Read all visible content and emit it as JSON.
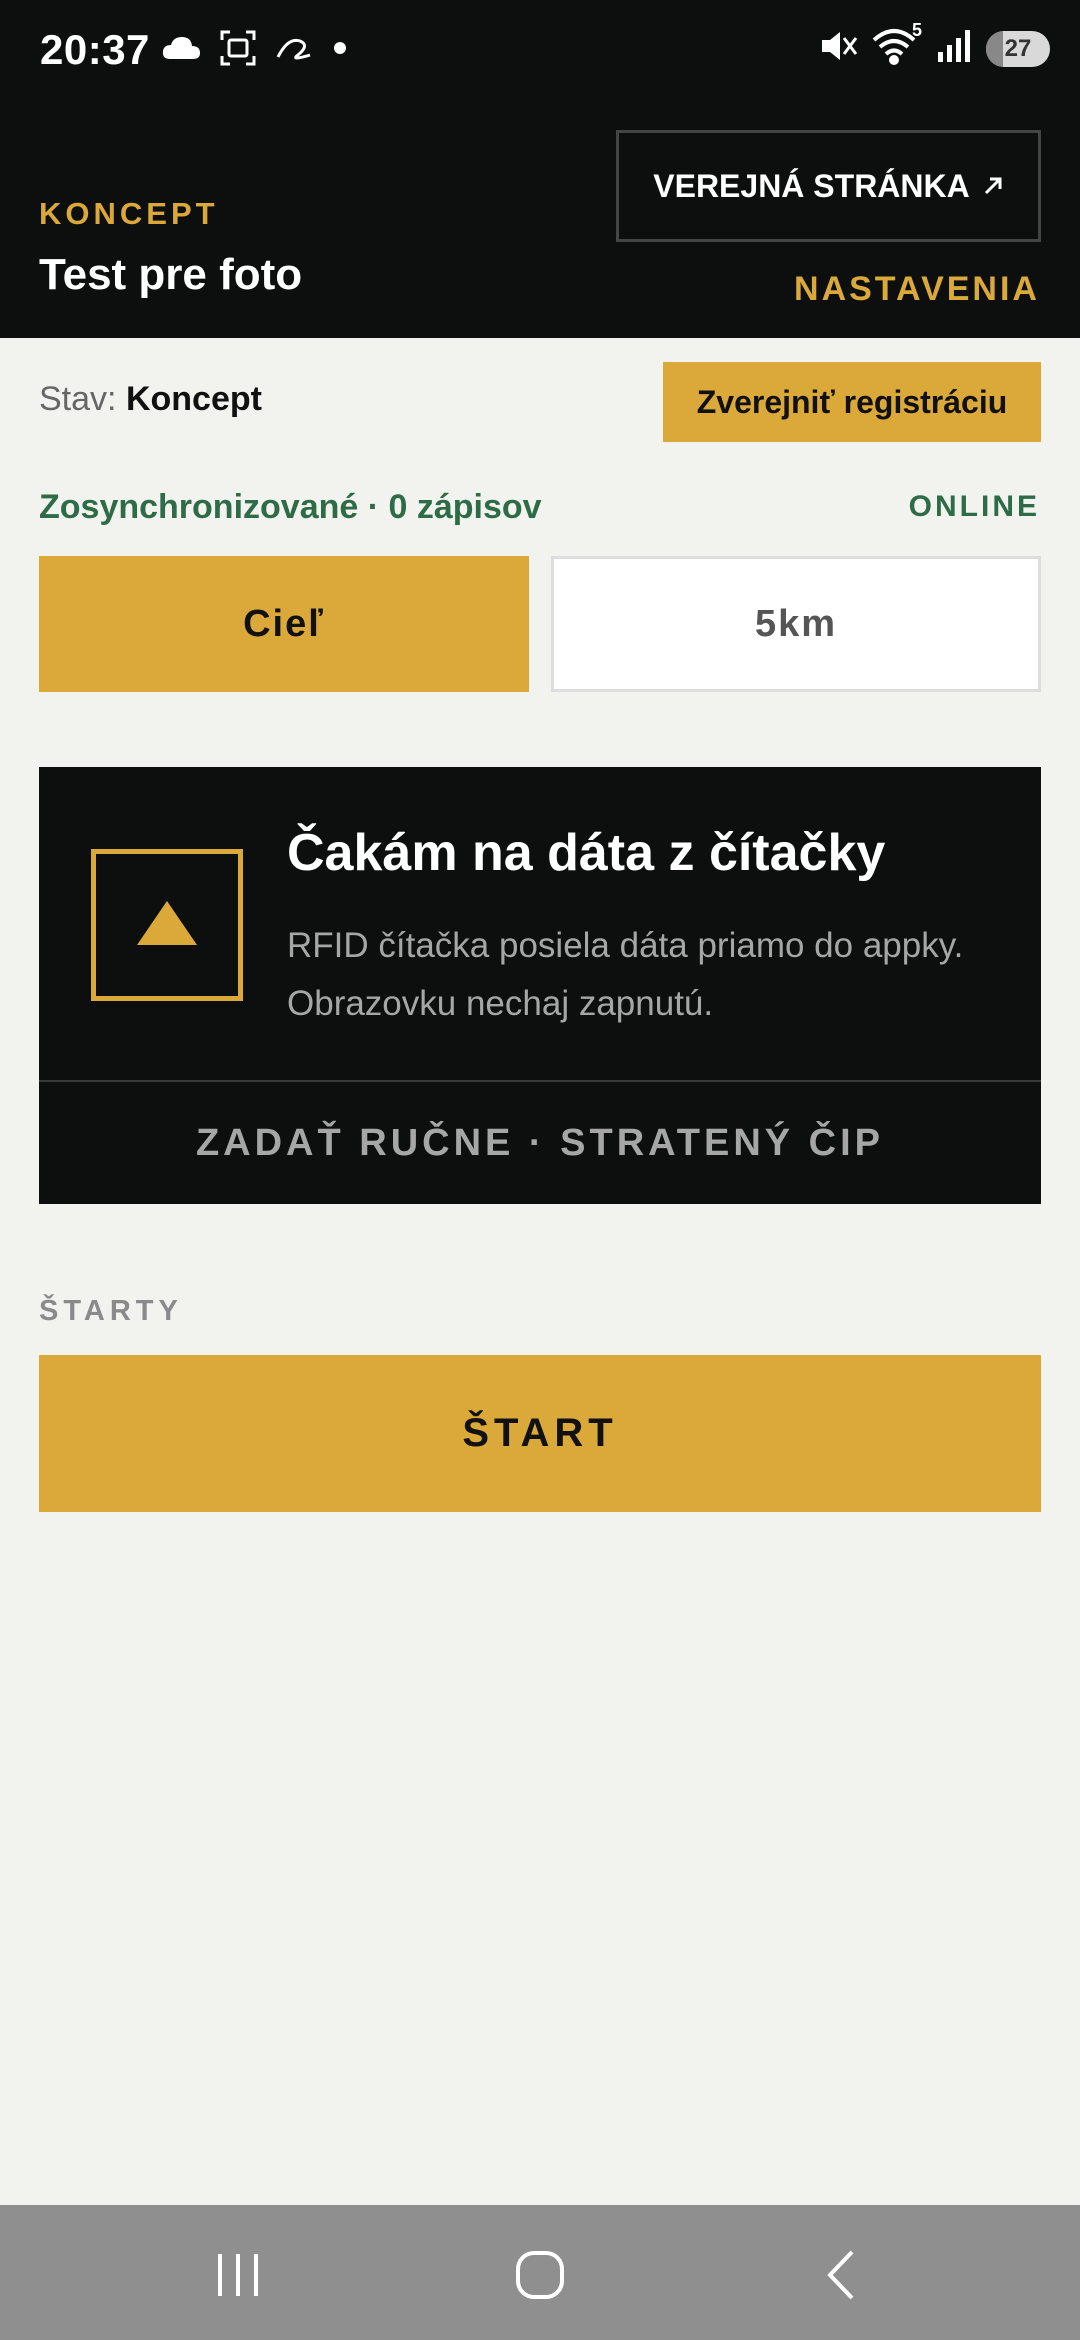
{
  "status_bar": {
    "time": "20:37",
    "icons": [
      "cloud-icon",
      "screenshot-icon",
      "app-icon",
      "dot-icon"
    ],
    "right_icons": [
      "mute-icon",
      "wifi-icon",
      "signal-icon"
    ],
    "wifi_badge": "5",
    "battery": "27",
    "battery_level": 0.27
  },
  "header": {
    "status_label": "KONCEPT",
    "title": "Test pre foto",
    "public_page_button": "VEREJNÁ STRÁNKA",
    "public_page_icon": "external-arrow-icon",
    "settings_link": "NASTAVENIA"
  },
  "status_row": {
    "label": "Stav:",
    "value": "Koncept",
    "publish_button": "Zverejniť registráciu"
  },
  "sync": {
    "text": "Zosynchronizované · 0 zápisov",
    "connection": "ONLINE"
  },
  "tabs": [
    {
      "label": "Cieľ",
      "active": true
    },
    {
      "label": "5km",
      "active": false
    }
  ],
  "reader": {
    "icon": "triangle-icon",
    "title": "Čakám na dáta z čítačky",
    "description": "RFID čítačka posiela dáta priamo do appky. Obrazovku nechaj zapnutú.",
    "manual_link": "ZADAŤ RUČNE · STRATENÝ ČIP"
  },
  "starts": {
    "section_label": "ŠTARTY",
    "start_button": "ŠTART"
  },
  "nav": {
    "icons": [
      "recent-apps-icon",
      "home-icon",
      "back-icon"
    ]
  },
  "colors": {
    "accent": "#dba83a",
    "dark": "#0d0f0f",
    "online_green": "#2e6b47",
    "background": "#f2f2ef"
  }
}
